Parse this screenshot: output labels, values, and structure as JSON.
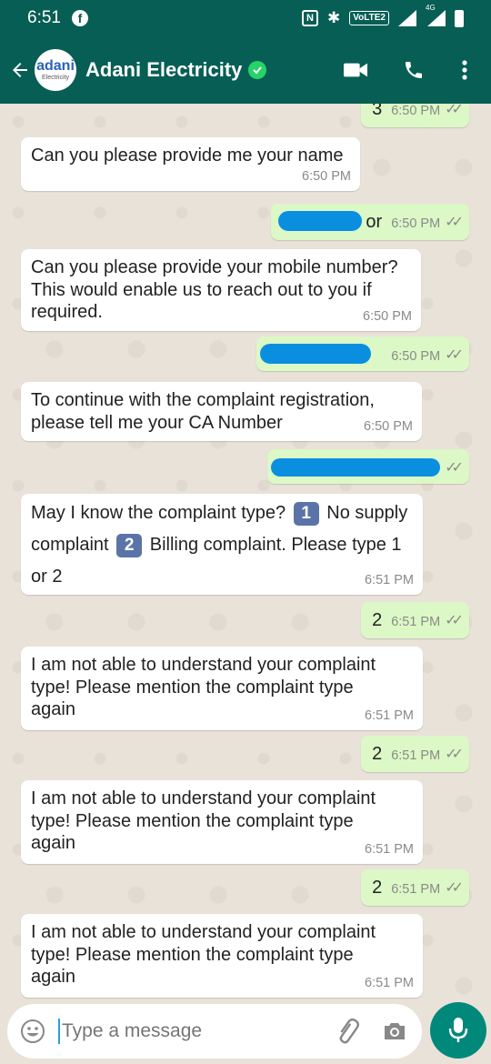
{
  "status_bar": {
    "time": "6:51",
    "fb_glyph": "f",
    "nfc_glyph": "N",
    "bt_glyph": "✱",
    "volte_label": "VoLTE2",
    "network_label": "4G"
  },
  "header": {
    "contact_name": "Adani Electricity",
    "avatar_text": "adani",
    "avatar_subtext": "Electricity",
    "verified_glyph": "✓"
  },
  "messages": [
    {
      "dir": "out",
      "text": "3",
      "time": "6:50 PM"
    },
    {
      "dir": "in",
      "text": "Can you please provide me your name",
      "time": "6:50 PM"
    },
    {
      "dir": "out",
      "text": "or",
      "time": "6:50 PM",
      "redacted": true
    },
    {
      "dir": "in",
      "text": "Can you please provide your mobile number? This would enable us to reach out to you if required.",
      "time": "6:50 PM"
    },
    {
      "dir": "out",
      "text": "",
      "time": "6:50 PM",
      "redacted": true
    },
    {
      "dir": "in",
      "text": "To continue with the complaint registration, please tell me your CA Number",
      "time": "6:50 PM"
    },
    {
      "dir": "out",
      "text": "",
      "time": "",
      "redacted": true
    },
    {
      "dir": "in",
      "text_parts": [
        "May I know the complaint type?",
        "1",
        "No supply complaint",
        "2",
        "Billing complaint. Please type 1 or 2"
      ],
      "time": "6:51 PM"
    },
    {
      "dir": "out",
      "text": "2",
      "time": "6:51 PM"
    },
    {
      "dir": "in",
      "text": "I am not able to understand your complaint type! Please mention the complaint type again",
      "time": "6:51 PM"
    },
    {
      "dir": "out",
      "text": "2",
      "time": "6:51 PM"
    },
    {
      "dir": "in",
      "text": "I am not able to understand your complaint type! Please mention the complaint type again",
      "time": "6:51 PM"
    },
    {
      "dir": "out",
      "text": "2",
      "time": "6:51 PM"
    },
    {
      "dir": "in",
      "text": "I am not able to understand your complaint type! Please mention the complaint type again",
      "time": "6:51 PM"
    }
  ],
  "ticks_glyph": "✓✓",
  "input": {
    "placeholder": "Type a message"
  },
  "icons": {
    "back": "arrow-left-icon",
    "video": "video-camera-icon",
    "call": "phone-icon",
    "menu": "more-vert-icon",
    "emoji": "smiley-icon",
    "attach": "paperclip-icon",
    "camera": "camera-icon",
    "mic": "microphone-icon"
  },
  "colors": {
    "header": "#075e54",
    "outgoing_bubble": "#dcf8c6",
    "incoming_bubble": "#ffffff",
    "chat_background": "#e9e2d9",
    "mic_button": "#00897b",
    "redaction": "#0a8fe0"
  }
}
